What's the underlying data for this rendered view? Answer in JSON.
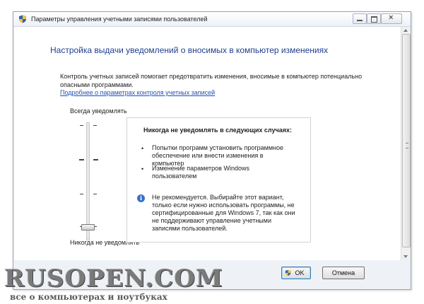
{
  "window": {
    "title": "Параметры управления учетными записями пользователей",
    "title_icon": "uac-shield-icon"
  },
  "content": {
    "heading": "Настройка выдачи уведомлений о вносимых в компьютер изменениях",
    "description": "Контроль учетных записей помогает предотвратить изменения, вносимые в компьютер потенциально опасными программами.",
    "link": "Подробнее о параметрах контроля учетных записей"
  },
  "slider": {
    "top_label": "Всегда уведомлять",
    "bottom_label": "Никогда не уведомлять",
    "levels": 4,
    "selected_level": 1
  },
  "info": {
    "title": "Никогда не уведомлять в следующих случаях:",
    "bullets": [
      "Попытки программ установить программное обеспечение или внести изменения в компьютер",
      "Изменение параметров Windows пользователем"
    ],
    "note_icon": "info-icon",
    "note": "Не рекомендуется. Выбирайте этот вариант, только если нужно использовать программы, не сертифицированные для Windows 7, так как они не поддерживают управление учетными записями пользователей."
  },
  "buttons": {
    "ok": "OK",
    "cancel": "Отмена"
  },
  "watermark": {
    "title": "RUSOPEN.COM",
    "subtitle": "все о компьютерах и ноутбуках"
  }
}
